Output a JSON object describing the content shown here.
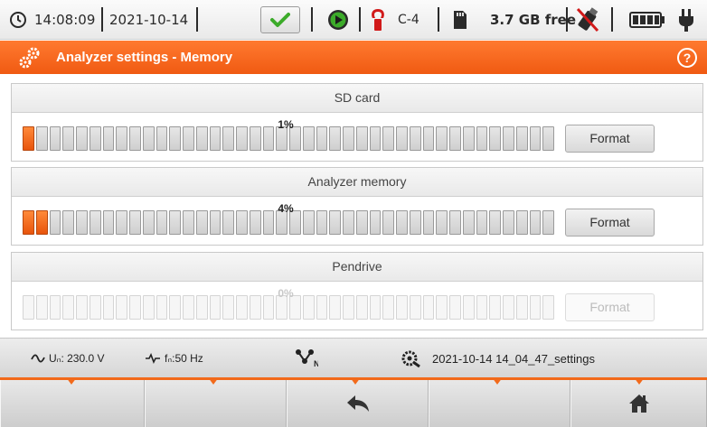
{
  "statusbar": {
    "time": "14:08:09",
    "date": "2021-10-14",
    "clamp": "C-4",
    "free_space": "3.7 GB free"
  },
  "titlebar": {
    "title": "Analyzer settings - Memory"
  },
  "memories": [
    {
      "name": "SD card",
      "usage_label": "1%",
      "usage": 0.01,
      "filled_segments": 1,
      "format_label": "Format",
      "enabled": true
    },
    {
      "name": "Analyzer memory",
      "usage_label": "4%",
      "usage": 0.04,
      "filled_segments": 2,
      "format_label": "Format",
      "enabled": true
    },
    {
      "name": "Pendrive",
      "usage_label": "0%",
      "usage": 0.0,
      "filled_segments": 0,
      "format_label": "Format",
      "enabled": false
    }
  ],
  "infobar": {
    "voltage": "Uₙ: 230.0 V",
    "frequency": "fₙ:50 Hz",
    "settings_file": "2021-10-14 14_04_47_settings"
  },
  "colors": {
    "accent": "#f26a1b",
    "ok_green": "#3cab2a",
    "clamp_red": "#d11a1a"
  },
  "icons": [
    "clock-icon",
    "checkmark-icon",
    "play-icon",
    "clamp-icon",
    "sd-card-icon",
    "usb-disabled-icon",
    "battery-icon",
    "plug-icon",
    "gears-icon",
    "help-icon",
    "sine-icon",
    "frequency-icon",
    "network-icon",
    "settings-file-icon",
    "back-icon",
    "home-icon"
  ]
}
